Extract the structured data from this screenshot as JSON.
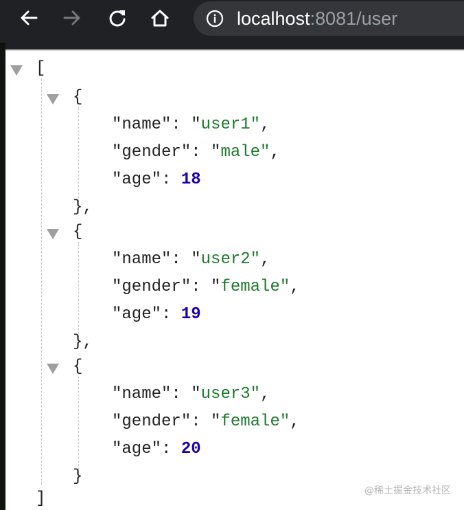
{
  "browser": {
    "url_host": "localhost",
    "url_rest": ":8081/user",
    "icons": {
      "back": "arrow-left-icon",
      "forward": "arrow-right-icon",
      "reload": "reload-icon",
      "home": "home-icon",
      "info": "info-icon"
    }
  },
  "json_viewer": {
    "open_array": "[",
    "close_array": "]",
    "items": [
      {
        "name": "user1",
        "gender": "male",
        "age": 18
      },
      {
        "name": "user2",
        "gender": "female",
        "age": 19
      },
      {
        "name": "user3",
        "gender": "female",
        "age": 20
      }
    ],
    "keys": {
      "name": "\"name\"",
      "gender": "\"gender\"",
      "age": "\"age\""
    },
    "colors": {
      "string": "#1b7a2b",
      "number": "#1f00a8",
      "text": "#222222",
      "triangle": "#9f9f9f"
    }
  },
  "watermark": "@稀土掘金技术社区"
}
